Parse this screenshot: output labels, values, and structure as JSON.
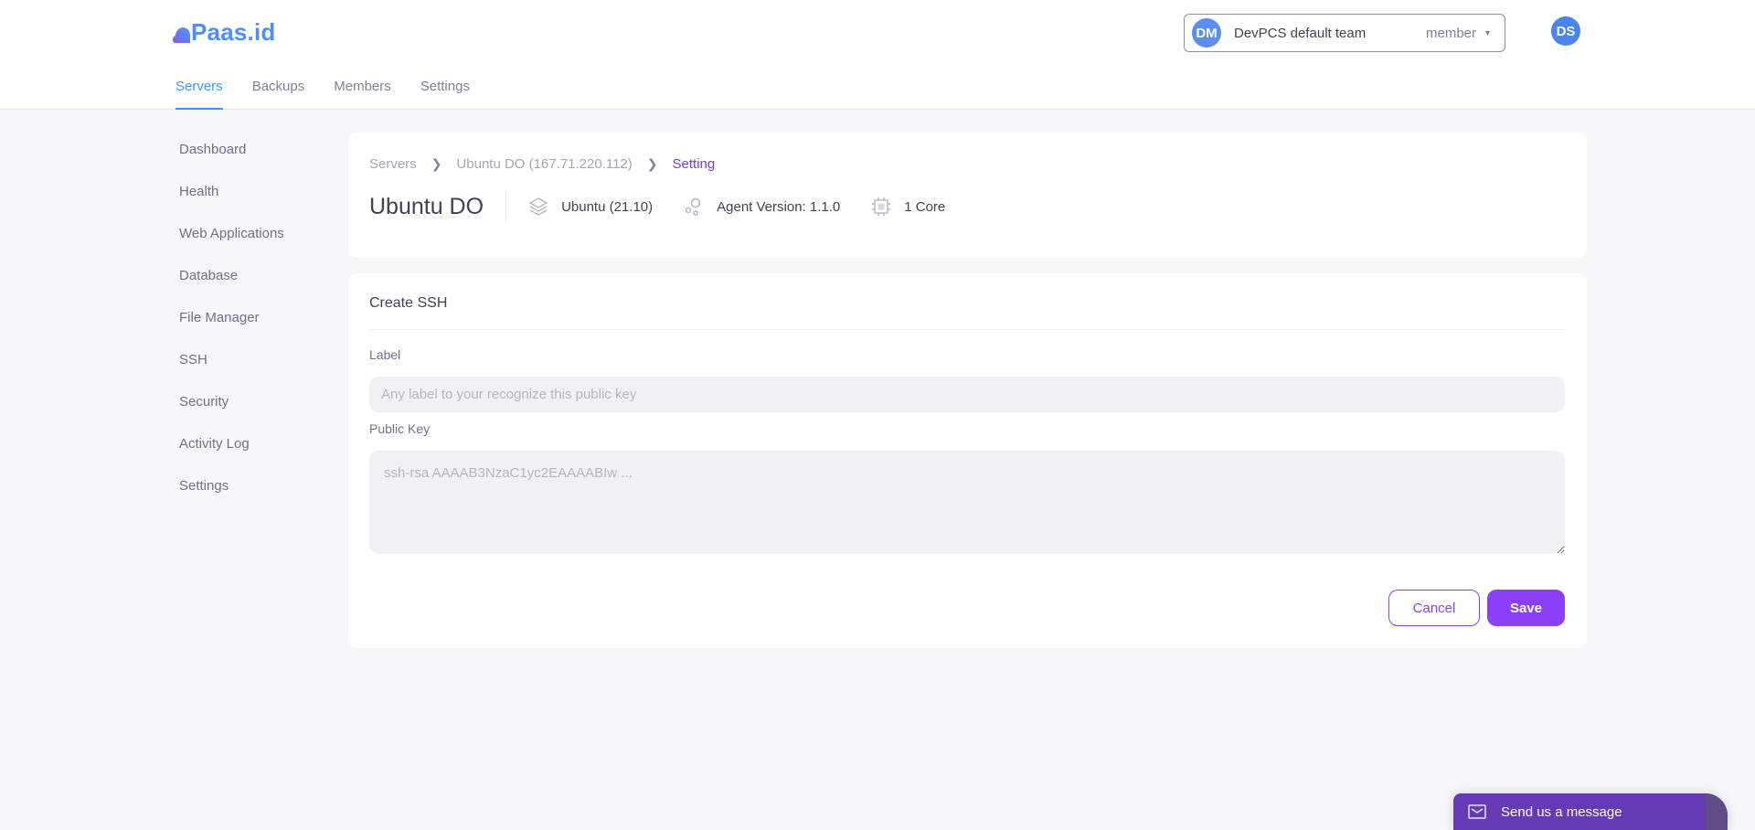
{
  "app": {
    "logo_text": "Paas.id",
    "brand_color": "#4f8ef7",
    "accent_color": "#8b3ff7"
  },
  "nav": {
    "tabs": [
      {
        "label": "Servers",
        "active": true
      },
      {
        "label": "Backups",
        "active": false
      },
      {
        "label": "Members",
        "active": false
      },
      {
        "label": "Settings",
        "active": false
      }
    ]
  },
  "team_selector": {
    "initials": "DM",
    "name": "DevPCS default team",
    "role": "member"
  },
  "user": {
    "initials": "DS"
  },
  "sidebar": {
    "items": [
      {
        "label": "Dashboard"
      },
      {
        "label": "Health"
      },
      {
        "label": "Web Applications"
      },
      {
        "label": "Database"
      },
      {
        "label": "File Manager"
      },
      {
        "label": "SSH"
      },
      {
        "label": "Security"
      },
      {
        "label": "Activity Log"
      },
      {
        "label": "Settings"
      }
    ]
  },
  "breadcrumb": {
    "items": [
      "Servers",
      "Ubuntu DO (167.71.220.112)",
      "Setting"
    ],
    "separator_icon": "chevron-right-icon"
  },
  "server": {
    "name": "Ubuntu DO",
    "os": "Ubuntu (21.10)",
    "agent_version": "Agent Version: 1.1.0",
    "cores": "1 Core"
  },
  "form": {
    "title": "Create SSH",
    "label_field": {
      "label": "Label",
      "value": "",
      "placeholder": "Any label to your recognize this public key"
    },
    "key_field": {
      "label": "Public Key",
      "value": "",
      "placeholder": "ssh-rsa AAAAB3NzaC1yc2EAAAABIw ..."
    },
    "cancel_label": "Cancel",
    "save_label": "Save"
  },
  "chat": {
    "label": "Send us a message",
    "icon": "envelope-icon"
  }
}
